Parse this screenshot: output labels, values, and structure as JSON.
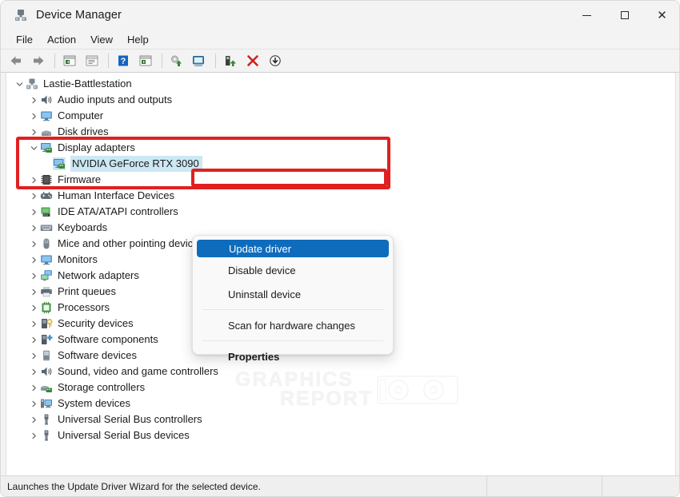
{
  "window": {
    "title": "Device Manager",
    "icon": "device-manager-icon",
    "controls": {
      "minimize": "minimize-icon",
      "maximize": "maximize-icon",
      "close": "close-icon"
    }
  },
  "menubar": {
    "items": [
      {
        "label": "File"
      },
      {
        "label": "Action"
      },
      {
        "label": "View"
      },
      {
        "label": "Help"
      }
    ]
  },
  "toolbar": {
    "buttons": [
      {
        "name": "back-icon",
        "tip": "Back"
      },
      {
        "name": "forward-icon",
        "tip": "Forward"
      },
      {
        "name": "show-hide-console-tree-icon",
        "tip": "Show/Hide console tree"
      },
      {
        "name": "properties-icon",
        "tip": "Properties"
      },
      {
        "name": "help-icon",
        "tip": "Help"
      },
      {
        "name": "scan-for-hardware-changes-icon",
        "tip": "Scan for hardware changes"
      },
      {
        "name": "update-driver-icon",
        "tip": "Update driver"
      },
      {
        "name": "display-devices-icon",
        "tip": "Devices by type"
      },
      {
        "name": "enable-device-icon",
        "tip": "Enable device"
      },
      {
        "name": "uninstall-device-icon",
        "tip": "Uninstall device"
      },
      {
        "name": "disable-device-icon",
        "tip": "Disable device"
      }
    ]
  },
  "tree": {
    "root": {
      "label": "Lastie-Battlestation",
      "icon": "computer-root-icon",
      "expanded": true
    },
    "items": [
      {
        "label": "Audio inputs and outputs",
        "icon": "speaker-icon",
        "depth": 1,
        "expanded": false
      },
      {
        "label": "Computer",
        "icon": "monitor-icon",
        "depth": 1,
        "expanded": false
      },
      {
        "label": "Disk drives",
        "icon": "disk-drive-icon",
        "depth": 1,
        "expanded": false
      },
      {
        "label": "Display adapters",
        "icon": "display-adapter-icon",
        "depth": 1,
        "expanded": true
      },
      {
        "label": "NVIDIA GeForce RTX 3090",
        "icon": "display-adapter-icon",
        "depth": 2,
        "selected": true
      },
      {
        "label": "Firmware",
        "icon": "firmware-chip-icon",
        "depth": 1,
        "expanded": false
      },
      {
        "label": "Human Interface Devices",
        "icon": "gamepad-icon",
        "depth": 1,
        "expanded": false
      },
      {
        "label": "IDE ATA/ATAPI controllers",
        "icon": "ide-controller-icon",
        "depth": 1,
        "expanded": false
      },
      {
        "label": "Keyboards",
        "icon": "keyboard-icon",
        "depth": 1,
        "expanded": false
      },
      {
        "label": "Mice and other pointing devices",
        "icon": "mouse-icon",
        "depth": 1,
        "expanded": false
      },
      {
        "label": "Monitors",
        "icon": "monitor-icon",
        "depth": 1,
        "expanded": false
      },
      {
        "label": "Network adapters",
        "icon": "network-adapter-icon",
        "depth": 1,
        "expanded": false
      },
      {
        "label": "Print queues",
        "icon": "printer-icon",
        "depth": 1,
        "expanded": false
      },
      {
        "label": "Processors",
        "icon": "processor-icon",
        "depth": 1,
        "expanded": false
      },
      {
        "label": "Security devices",
        "icon": "security-device-icon",
        "depth": 1,
        "expanded": false
      },
      {
        "label": "Software components",
        "icon": "software-component-icon",
        "depth": 1,
        "expanded": false
      },
      {
        "label": "Software devices",
        "icon": "software-device-icon",
        "depth": 1,
        "expanded": false
      },
      {
        "label": "Sound, video and game controllers",
        "icon": "speaker-icon",
        "depth": 1,
        "expanded": false
      },
      {
        "label": "Storage controllers",
        "icon": "storage-controller-icon",
        "depth": 1,
        "expanded": false
      },
      {
        "label": "System devices",
        "icon": "system-device-icon",
        "depth": 1,
        "expanded": false
      },
      {
        "label": "Universal Serial Bus controllers",
        "icon": "usb-icon",
        "depth": 1,
        "expanded": false
      },
      {
        "label": "Universal Serial Bus devices",
        "icon": "usb-icon",
        "depth": 1,
        "expanded": false
      }
    ]
  },
  "context_menu": {
    "items": [
      {
        "label": "Update driver",
        "highlighted": true
      },
      {
        "label": "Disable device"
      },
      {
        "label": "Uninstall device"
      },
      {
        "separator_after": true
      },
      {
        "label": "Scan for hardware changes"
      },
      {
        "separator_after": true
      },
      {
        "label": "Properties",
        "bold": true
      }
    ]
  },
  "annotations": {
    "color": "#e02020",
    "boxes": [
      {
        "name": "display-adapters-highlight"
      },
      {
        "name": "update-driver-highlight"
      }
    ]
  },
  "watermark": {
    "line1": "GRAPHICS",
    "line2": "REPORT"
  },
  "statusbar": {
    "message": "Launches the Update Driver Wizard for the selected device.",
    "pane2": "",
    "pane3": ""
  }
}
